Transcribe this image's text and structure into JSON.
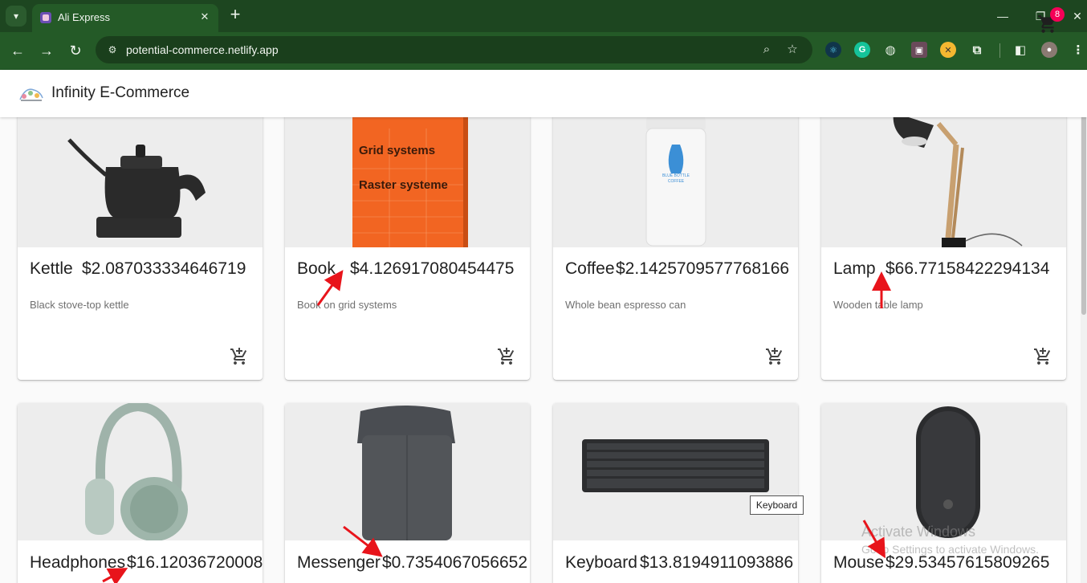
{
  "browser": {
    "tab_title": "Ali Express",
    "url": "potential-commerce.netlify.app",
    "new_tab_symbol": "+",
    "tab_close_symbol": "✕"
  },
  "app": {
    "title": "Infinity E-Commerce",
    "cart_count": "8"
  },
  "products": [
    {
      "name": "Kettle",
      "price": "$2.087033334646719",
      "description": "Black stove-top kettle"
    },
    {
      "name": "Book",
      "price": "$4.126917080454475",
      "description": "Book on grid systems"
    },
    {
      "name": "Coffee",
      "price": "$2.1425709577768166",
      "description": "Whole bean espresso can"
    },
    {
      "name": "Lamp",
      "price": "$66.77158422294134",
      "description": "Wooden table lamp"
    },
    {
      "name": "Headphones",
      "price": "$16.12036720008",
      "description": ""
    },
    {
      "name": "Messenger",
      "price": "$0.7354067056652",
      "description": ""
    },
    {
      "name": "Keyboard",
      "price": "$13.8194911093886",
      "description": ""
    },
    {
      "name": "Mouse",
      "price": "$29.53457615809265",
      "description": ""
    }
  ],
  "book_cover": {
    "line1": "Grid systems",
    "line2": "Raster systeme"
  },
  "coffee_label": {
    "line1": "BLUE BOTTLE",
    "line2": "COFFEE"
  },
  "tooltip": "Keyboard",
  "watermark": {
    "title": "Activate Windows",
    "subtitle": "Go to Settings to activate Windows."
  },
  "colors": {
    "chrome_dark": "#1d4620",
    "chrome_toolbar": "#245a27",
    "badge": "#f50057",
    "annotation_arrow": "#e8141b"
  }
}
